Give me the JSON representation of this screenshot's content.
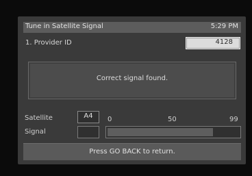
{
  "header": {
    "title": "Tune in Satellite Signal",
    "time": "5:29 PM"
  },
  "provider": {
    "label": "1. Provider ID",
    "value": "4128"
  },
  "message": "Correct signal found.",
  "satellite": {
    "label": "Satellite",
    "value": "A4"
  },
  "signal": {
    "label": "Signal",
    "scale_min": "0",
    "scale_mid": "50",
    "scale_max": "99",
    "level_fraction": 0.8
  },
  "footer": {
    "instruction": "Press GO BACK to return."
  }
}
